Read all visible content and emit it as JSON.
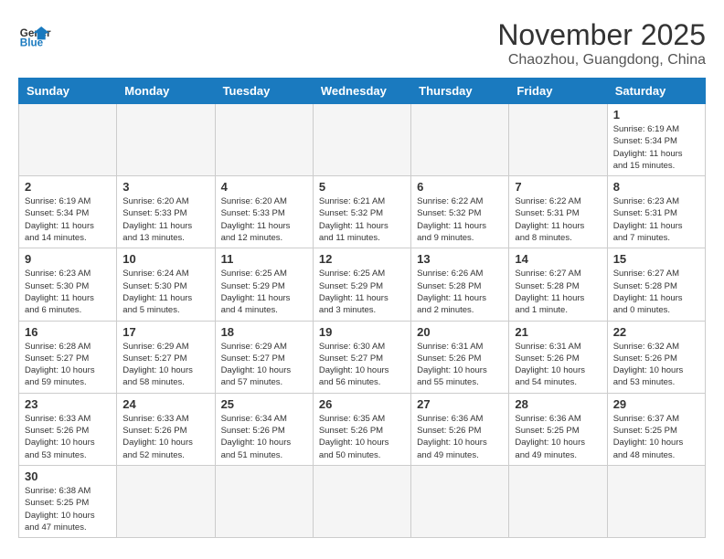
{
  "logo": {
    "text_general": "General",
    "text_blue": "Blue"
  },
  "title": "November 2025",
  "location": "Chaozhou, Guangdong, China",
  "days_of_week": [
    "Sunday",
    "Monday",
    "Tuesday",
    "Wednesday",
    "Thursday",
    "Friday",
    "Saturday"
  ],
  "weeks": [
    [
      {
        "day": "",
        "info": ""
      },
      {
        "day": "",
        "info": ""
      },
      {
        "day": "",
        "info": ""
      },
      {
        "day": "",
        "info": ""
      },
      {
        "day": "",
        "info": ""
      },
      {
        "day": "",
        "info": ""
      },
      {
        "day": "1",
        "info": "Sunrise: 6:19 AM\nSunset: 5:34 PM\nDaylight: 11 hours\nand 15 minutes."
      }
    ],
    [
      {
        "day": "2",
        "info": "Sunrise: 6:19 AM\nSunset: 5:34 PM\nDaylight: 11 hours\nand 14 minutes."
      },
      {
        "day": "3",
        "info": "Sunrise: 6:20 AM\nSunset: 5:33 PM\nDaylight: 11 hours\nand 13 minutes."
      },
      {
        "day": "4",
        "info": "Sunrise: 6:20 AM\nSunset: 5:33 PM\nDaylight: 11 hours\nand 12 minutes."
      },
      {
        "day": "5",
        "info": "Sunrise: 6:21 AM\nSunset: 5:32 PM\nDaylight: 11 hours\nand 11 minutes."
      },
      {
        "day": "6",
        "info": "Sunrise: 6:22 AM\nSunset: 5:32 PM\nDaylight: 11 hours\nand 9 minutes."
      },
      {
        "day": "7",
        "info": "Sunrise: 6:22 AM\nSunset: 5:31 PM\nDaylight: 11 hours\nand 8 minutes."
      },
      {
        "day": "8",
        "info": "Sunrise: 6:23 AM\nSunset: 5:31 PM\nDaylight: 11 hours\nand 7 minutes."
      }
    ],
    [
      {
        "day": "9",
        "info": "Sunrise: 6:23 AM\nSunset: 5:30 PM\nDaylight: 11 hours\nand 6 minutes."
      },
      {
        "day": "10",
        "info": "Sunrise: 6:24 AM\nSunset: 5:30 PM\nDaylight: 11 hours\nand 5 minutes."
      },
      {
        "day": "11",
        "info": "Sunrise: 6:25 AM\nSunset: 5:29 PM\nDaylight: 11 hours\nand 4 minutes."
      },
      {
        "day": "12",
        "info": "Sunrise: 6:25 AM\nSunset: 5:29 PM\nDaylight: 11 hours\nand 3 minutes."
      },
      {
        "day": "13",
        "info": "Sunrise: 6:26 AM\nSunset: 5:28 PM\nDaylight: 11 hours\nand 2 minutes."
      },
      {
        "day": "14",
        "info": "Sunrise: 6:27 AM\nSunset: 5:28 PM\nDaylight: 11 hours\nand 1 minute."
      },
      {
        "day": "15",
        "info": "Sunrise: 6:27 AM\nSunset: 5:28 PM\nDaylight: 11 hours\nand 0 minutes."
      }
    ],
    [
      {
        "day": "16",
        "info": "Sunrise: 6:28 AM\nSunset: 5:27 PM\nDaylight: 10 hours\nand 59 minutes."
      },
      {
        "day": "17",
        "info": "Sunrise: 6:29 AM\nSunset: 5:27 PM\nDaylight: 10 hours\nand 58 minutes."
      },
      {
        "day": "18",
        "info": "Sunrise: 6:29 AM\nSunset: 5:27 PM\nDaylight: 10 hours\nand 57 minutes."
      },
      {
        "day": "19",
        "info": "Sunrise: 6:30 AM\nSunset: 5:27 PM\nDaylight: 10 hours\nand 56 minutes."
      },
      {
        "day": "20",
        "info": "Sunrise: 6:31 AM\nSunset: 5:26 PM\nDaylight: 10 hours\nand 55 minutes."
      },
      {
        "day": "21",
        "info": "Sunrise: 6:31 AM\nSunset: 5:26 PM\nDaylight: 10 hours\nand 54 minutes."
      },
      {
        "day": "22",
        "info": "Sunrise: 6:32 AM\nSunset: 5:26 PM\nDaylight: 10 hours\nand 53 minutes."
      }
    ],
    [
      {
        "day": "23",
        "info": "Sunrise: 6:33 AM\nSunset: 5:26 PM\nDaylight: 10 hours\nand 53 minutes."
      },
      {
        "day": "24",
        "info": "Sunrise: 6:33 AM\nSunset: 5:26 PM\nDaylight: 10 hours\nand 52 minutes."
      },
      {
        "day": "25",
        "info": "Sunrise: 6:34 AM\nSunset: 5:26 PM\nDaylight: 10 hours\nand 51 minutes."
      },
      {
        "day": "26",
        "info": "Sunrise: 6:35 AM\nSunset: 5:26 PM\nDaylight: 10 hours\nand 50 minutes."
      },
      {
        "day": "27",
        "info": "Sunrise: 6:36 AM\nSunset: 5:26 PM\nDaylight: 10 hours\nand 49 minutes."
      },
      {
        "day": "28",
        "info": "Sunrise: 6:36 AM\nSunset: 5:25 PM\nDaylight: 10 hours\nand 49 minutes."
      },
      {
        "day": "29",
        "info": "Sunrise: 6:37 AM\nSunset: 5:25 PM\nDaylight: 10 hours\nand 48 minutes."
      }
    ],
    [
      {
        "day": "30",
        "info": "Sunrise: 6:38 AM\nSunset: 5:25 PM\nDaylight: 10 hours\nand 47 minutes."
      },
      {
        "day": "",
        "info": ""
      },
      {
        "day": "",
        "info": ""
      },
      {
        "day": "",
        "info": ""
      },
      {
        "day": "",
        "info": ""
      },
      {
        "day": "",
        "info": ""
      },
      {
        "day": "",
        "info": ""
      }
    ]
  ]
}
